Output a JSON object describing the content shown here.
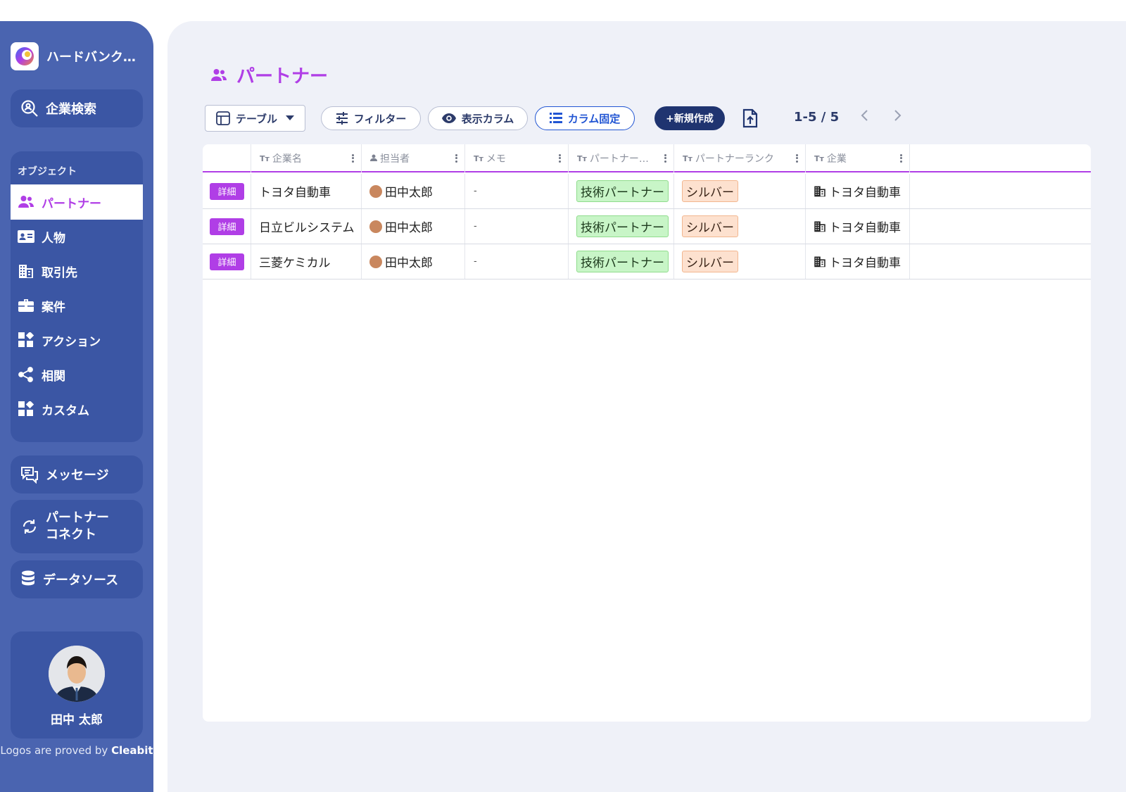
{
  "brand": {
    "name": "ハードバンク…"
  },
  "sidebar": {
    "search_label": "企業検索",
    "objects_title": "オブジェクト",
    "items": [
      {
        "label": "パートナー",
        "icon": "people-icon",
        "active": true
      },
      {
        "label": "人物",
        "icon": "contact-card-icon"
      },
      {
        "label": "取引先",
        "icon": "building-icon"
      },
      {
        "label": "案件",
        "icon": "briefcase-icon"
      },
      {
        "label": "アクション",
        "icon": "widgets-icon"
      },
      {
        "label": "相関",
        "icon": "share-icon"
      },
      {
        "label": "カスタム",
        "icon": "widgets-icon"
      }
    ],
    "message_label": "メッセージ",
    "partner_connect_line1": "パートナー",
    "partner_connect_line2": "コネクト",
    "datasource_label": "データソース",
    "user_name": "田中 太郎",
    "credit_prefix": "Logos are proved by",
    "credit_brand": "Cleabit"
  },
  "main": {
    "title": "パートナー",
    "toolbar": {
      "view_label": "テーブル",
      "filter_label": "フィルター",
      "columns_label": "表示カラム",
      "fix_label": "カラム固定",
      "new_label": "+新規作成"
    },
    "pager": "1-5 / 5"
  },
  "table": {
    "headers": [
      "企業名",
      "担当者",
      "メモ",
      "パートナー…",
      "パートナーランク",
      "企業"
    ],
    "detail_label": "詳細",
    "rows": [
      {
        "company": "トヨタ自動車",
        "owner": "田中太郎",
        "memo": "-",
        "type": "技術パートナー",
        "rank": "シルバー",
        "org": "トヨタ自動車"
      },
      {
        "company": "日立ビルシステム",
        "owner": "田中太郎",
        "memo": "-",
        "type": "技術パートナー",
        "rank": "シルバー",
        "org": "トヨタ自動車"
      },
      {
        "company": "三菱ケミカル",
        "owner": "田中太郎",
        "memo": "-",
        "type": "技術パートナー",
        "rank": "シルバー",
        "org": "トヨタ自動車"
      }
    ]
  },
  "colors": {
    "sidebar": "#4a64b0",
    "accent": "#b03ee6",
    "navy": "#1f3470",
    "link": "#2155d3"
  }
}
